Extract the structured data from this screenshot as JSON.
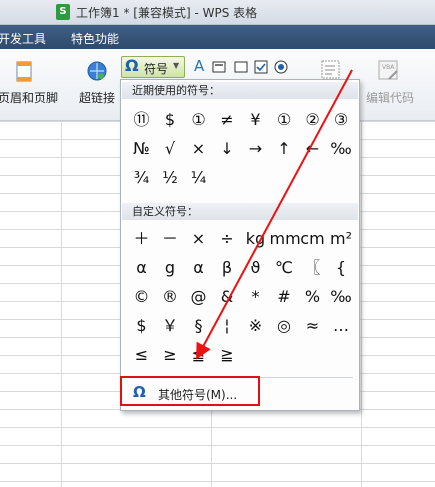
{
  "window": {
    "app_icon": "S",
    "title": "工作簿1 * [兼容模式] - WPS 表格"
  },
  "tabs": [
    "开发工具",
    "特色功能"
  ],
  "ribbon": {
    "header_footer": "页眉和页脚",
    "hyperlink": "超链接",
    "symbol_button": "符号",
    "text_box_letter": "A",
    "edit_code": "编辑代码"
  },
  "menu": {
    "recent_header": "近期使用的符号：",
    "recent_symbols": [
      "⑪",
      "$",
      "①",
      "≠",
      "¥",
      "①",
      "②",
      "③",
      "№",
      "√",
      "×",
      "↓",
      "→",
      "↑",
      "←",
      "‰",
      "¾",
      "½",
      "¼"
    ],
    "custom_header": "自定义符号：",
    "custom_symbols": [
      "＋",
      "－",
      "×",
      "÷",
      "kg",
      "mm",
      "cm",
      "m²",
      "α",
      "g",
      "α",
      "β",
      "ϑ",
      "℃",
      "〖",
      "{",
      "©",
      "®",
      "@",
      "&",
      "*",
      "#",
      "%",
      "‰",
      "$",
      "￥",
      "§",
      "¦",
      "※",
      "◎",
      "≈",
      "…",
      "≤",
      "≥",
      "≦",
      "≧"
    ],
    "other_symbols": "其他符号(M)..."
  },
  "annotation": {
    "highlight_color": "#e11111",
    "arrow_color": "#e11111"
  }
}
